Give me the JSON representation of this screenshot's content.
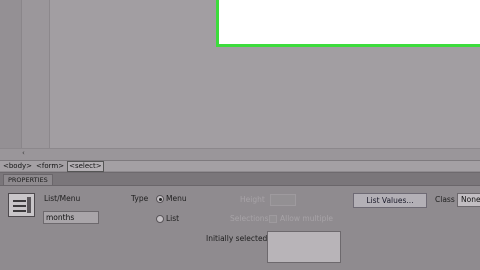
{
  "tag_selector": {
    "tags": [
      "<body>",
      "<form>",
      "<select>"
    ],
    "selected": "<select>"
  },
  "properties": {
    "tab_label": "PROPERTIES",
    "element_type": "List/Menu",
    "name_value": "months",
    "type_label": "Type",
    "type_options": {
      "menu": "Menu",
      "list": "List"
    },
    "type_selected": "Menu",
    "height_label": "Height",
    "selections_label": "Selections",
    "allow_multiple_label": "Allow multiple",
    "list_values_button": "List Values...",
    "class_label": "Class",
    "class_value": "None",
    "initially_selected_label": "Initially selected"
  },
  "colors": {
    "form_outline": "#3ddc3d",
    "panel_bg": "#8f8b8f"
  }
}
